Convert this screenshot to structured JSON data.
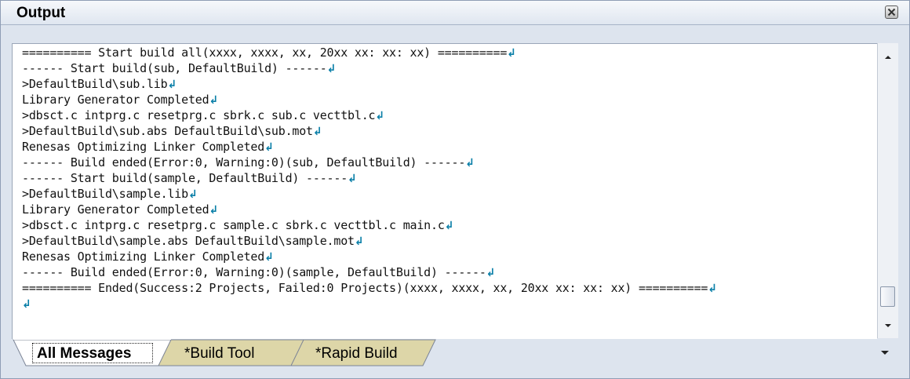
{
  "panel": {
    "title": "Output",
    "close_icon": "close-icon"
  },
  "output": {
    "lines": [
      "========== Start build all(xxxx, xxxx, xx, 20xx xx: xx: xx) ==========",
      "------ Start build(sub, DefaultBuild) ------",
      ">DefaultBuild\\sub.lib",
      "Library Generator Completed",
      ">dbsct.c intprg.c resetprg.c sbrk.c sub.c vecttbl.c",
      ">DefaultBuild\\sub.abs DefaultBuild\\sub.mot",
      "Renesas Optimizing Linker Completed",
      "------ Build ended(Error:0, Warning:0)(sub, DefaultBuild) ------",
      "------ Start build(sample, DefaultBuild) ------",
      ">DefaultBuild\\sample.lib",
      "Library Generator Completed",
      ">dbsct.c intprg.c resetprg.c sample.c sbrk.c vecttbl.c main.c",
      ">DefaultBuild\\sample.abs DefaultBuild\\sample.mot",
      "Renesas Optimizing Linker Completed",
      "------ Build ended(Error:0, Warning:0)(sample, DefaultBuild) ------",
      "========== Ended(Success:2 Projects, Failed:0 Projects)(xxxx, xxxx, xx, 20xx xx: xx: xx) ==========",
      ""
    ],
    "line_end_glyph": "↲"
  },
  "tabs": [
    {
      "label": "All Messages",
      "active": true
    },
    {
      "label": "*Build Tool",
      "active": false
    },
    {
      "label": "*Rapid Build",
      "active": false
    }
  ],
  "scroll_position": 0.93,
  "colors": {
    "panel_bg": "#dde4ee",
    "active_tab": "#ffffff",
    "inactive_tab": "#ddd6a8",
    "line_end_marker": "#0a7fa8"
  }
}
